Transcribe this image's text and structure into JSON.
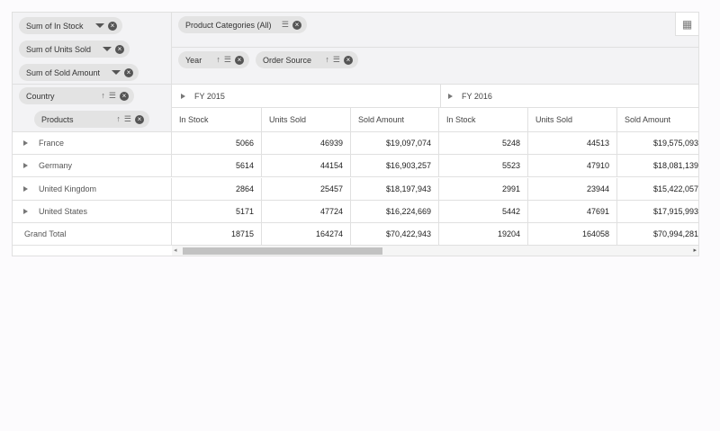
{
  "values_fields": [
    {
      "label": "Sum of In Stock"
    },
    {
      "label": "Sum of Units Sold"
    },
    {
      "label": "Sum of Sold Amount"
    }
  ],
  "filters": [
    {
      "label": "Product Categories (All)"
    }
  ],
  "columns_fields": [
    {
      "label": "Year"
    },
    {
      "label": "Order Source"
    }
  ],
  "rows_fields": [
    {
      "label": "Country"
    },
    {
      "label": "Products"
    }
  ],
  "settings_icon": "grid-settings-icon",
  "years": [
    {
      "label": "FY 2015"
    },
    {
      "label": "FY 2016"
    }
  ],
  "measures": [
    "In Stock",
    "Units Sold",
    "Sold Amount",
    "In Stock",
    "Units Sold",
    "Sold Amount"
  ],
  "rows": [
    {
      "label": "France",
      "values": [
        "5066",
        "46939",
        "$19,097,074",
        "5248",
        "44513",
        "$19,575,093"
      ]
    },
    {
      "label": "Germany",
      "values": [
        "5614",
        "44154",
        "$16,903,257",
        "5523",
        "47910",
        "$18,081,139"
      ]
    },
    {
      "label": "United Kingdom",
      "values": [
        "2864",
        "25457",
        "$18,197,943",
        "2991",
        "23944",
        "$15,422,057"
      ]
    },
    {
      "label": "United States",
      "values": [
        "5171",
        "47724",
        "$16,224,669",
        "5442",
        "47691",
        "$17,915,993"
      ]
    }
  ],
  "grand_total": {
    "label": "Grand Total",
    "values": [
      "18715",
      "164274",
      "$70,422,943",
      "19204",
      "164058",
      "$70,994,281"
    ]
  }
}
